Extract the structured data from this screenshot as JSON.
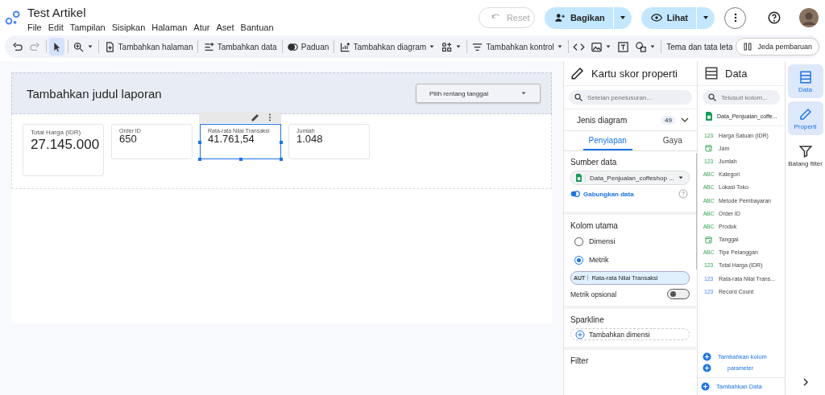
{
  "header": {
    "title": "Test Artikel",
    "menu": [
      "File",
      "Edit",
      "Tampilan",
      "Sisipkan",
      "Halaman",
      "Atur",
      "Aset",
      "Bantuan"
    ],
    "reset": {
      "label": "Reset",
      "disabled": true
    },
    "share": "Bagikan",
    "view": "Lihat"
  },
  "toolbar": [
    {
      "kind": "icon"
    },
    {
      "kind": "icon",
      "disabled": true
    },
    {
      "kind": "sep"
    },
    {
      "kind": "icon",
      "selected": true
    },
    {
      "kind": "sep"
    },
    {
      "kind": "icon",
      "caret": true
    },
    {
      "kind": "sep"
    },
    {
      "kind": "button",
      "label": "Tambahkan halaman"
    },
    {
      "kind": "sep"
    },
    {
      "kind": "button",
      "label": "Tambahkan data"
    },
    {
      "kind": "sep"
    },
    {
      "kind": "button",
      "label": "Paduan"
    },
    {
      "kind": "sep"
    },
    {
      "kind": "button",
      "label": "Tambahkan diagram",
      "caret": true
    },
    {
      "kind": "icon",
      "caret": true
    },
    {
      "kind": "sep"
    },
    {
      "kind": "button",
      "label": "Tambahkan kontrol",
      "caret": true
    },
    {
      "kind": "sep"
    },
    {
      "kind": "icon"
    },
    {
      "kind": "icon",
      "caret": true
    },
    {
      "kind": "icon"
    },
    {
      "kind": "icon",
      "caret": true
    },
    {
      "kind": "sep"
    },
    {
      "kind": "label",
      "label": "Tema dan tata leta"
    }
  ],
  "pause": "Jeda pembaruan",
  "report": {
    "title": "Tambahkan judul laporan",
    "date_range": "Pilih rentang tanggal",
    "scorecards": [
      {
        "label": "Total Harga (IDR)",
        "value": "27.145.000",
        "kind": "large",
        "selected": false
      },
      {
        "label": "Order ID",
        "value": "650",
        "kind": "compact",
        "selected": false
      },
      {
        "label": "Rata-rata Nilai Transaksi",
        "value": "41.761,54",
        "kind": "compact",
        "selected": true
      },
      {
        "label": "Jumlah",
        "value": "1.048",
        "kind": "compact",
        "selected": false
      }
    ]
  },
  "properties": {
    "title": "Kartu skor properti",
    "search": {
      "placeholder": "Setelan penelusuran..."
    },
    "chart_type": "Jenis diagram",
    "chart_count": "49",
    "tabs": [
      {
        "label": "Penyiapan",
        "selected": true
      },
      {
        "label": "Gaya",
        "selected": false
      }
    ],
    "source_heading": "Sumber data",
    "source": "Data_Penjualan_coffeshop ...",
    "blend": "Gabungkan data",
    "main_heading": "Kolom utama",
    "radios": [
      {
        "label": "Dimensi",
        "selected": false
      },
      {
        "label": "Metrik",
        "selected": true
      }
    ],
    "metric_tag": "AUT",
    "metric": "Rata-rata Nilai Transaksi",
    "optional_label": "Metrik opsional",
    "optional_on": false,
    "sparkline_heading": "Sparkline",
    "add_dimension": "Tambahkan dimensi",
    "filter_heading": "Filter"
  },
  "data": {
    "title": "Data",
    "search": {
      "placeholder": "Telusuri kolom..."
    },
    "source": "Data_Penjualan_coffe...",
    "fields": [
      {
        "name": "Harga Satuan (IDR)",
        "kind": "number",
        "tag": "123",
        "calculated": false
      },
      {
        "name": "Jam",
        "kind": "date",
        "calculated": false
      },
      {
        "name": "Jumlah",
        "kind": "number",
        "tag": "123",
        "calculated": false
      },
      {
        "name": "Kategori",
        "kind": "text",
        "tag": "ABC",
        "calculated": false
      },
      {
        "name": "Lokasi Toko",
        "kind": "text",
        "tag": "ABC",
        "calculated": false
      },
      {
        "name": "Metode Pembayaran",
        "kind": "text",
        "tag": "ABC",
        "calculated": false
      },
      {
        "name": "Order ID",
        "kind": "text",
        "tag": "ABC",
        "calculated": false
      },
      {
        "name": "Produk",
        "kind": "text",
        "tag": "ABC",
        "calculated": false
      },
      {
        "name": "Tanggal",
        "kind": "date",
        "calculated": false
      },
      {
        "name": "Tipe Pelanggan",
        "kind": "text",
        "tag": "ABC",
        "calculated": false
      },
      {
        "name": "Total Harga (IDR)",
        "kind": "number",
        "tag": "123",
        "calculated": false
      },
      {
        "name": "Rata-rata Nilai Trans...",
        "kind": "number",
        "tag": "123",
        "calculated": true
      },
      {
        "name": "Record Count",
        "kind": "number",
        "tag": "123",
        "calculated": true
      }
    ],
    "add_field": "Tambahkan kolom",
    "add_param": "parameter",
    "add_data": "Tambahkan Data"
  },
  "rail": [
    {
      "label": "Data",
      "selected": true
    },
    {
      "label": "Properti",
      "selected": true
    },
    {
      "label": "Batang filter",
      "selected": false
    }
  ]
}
